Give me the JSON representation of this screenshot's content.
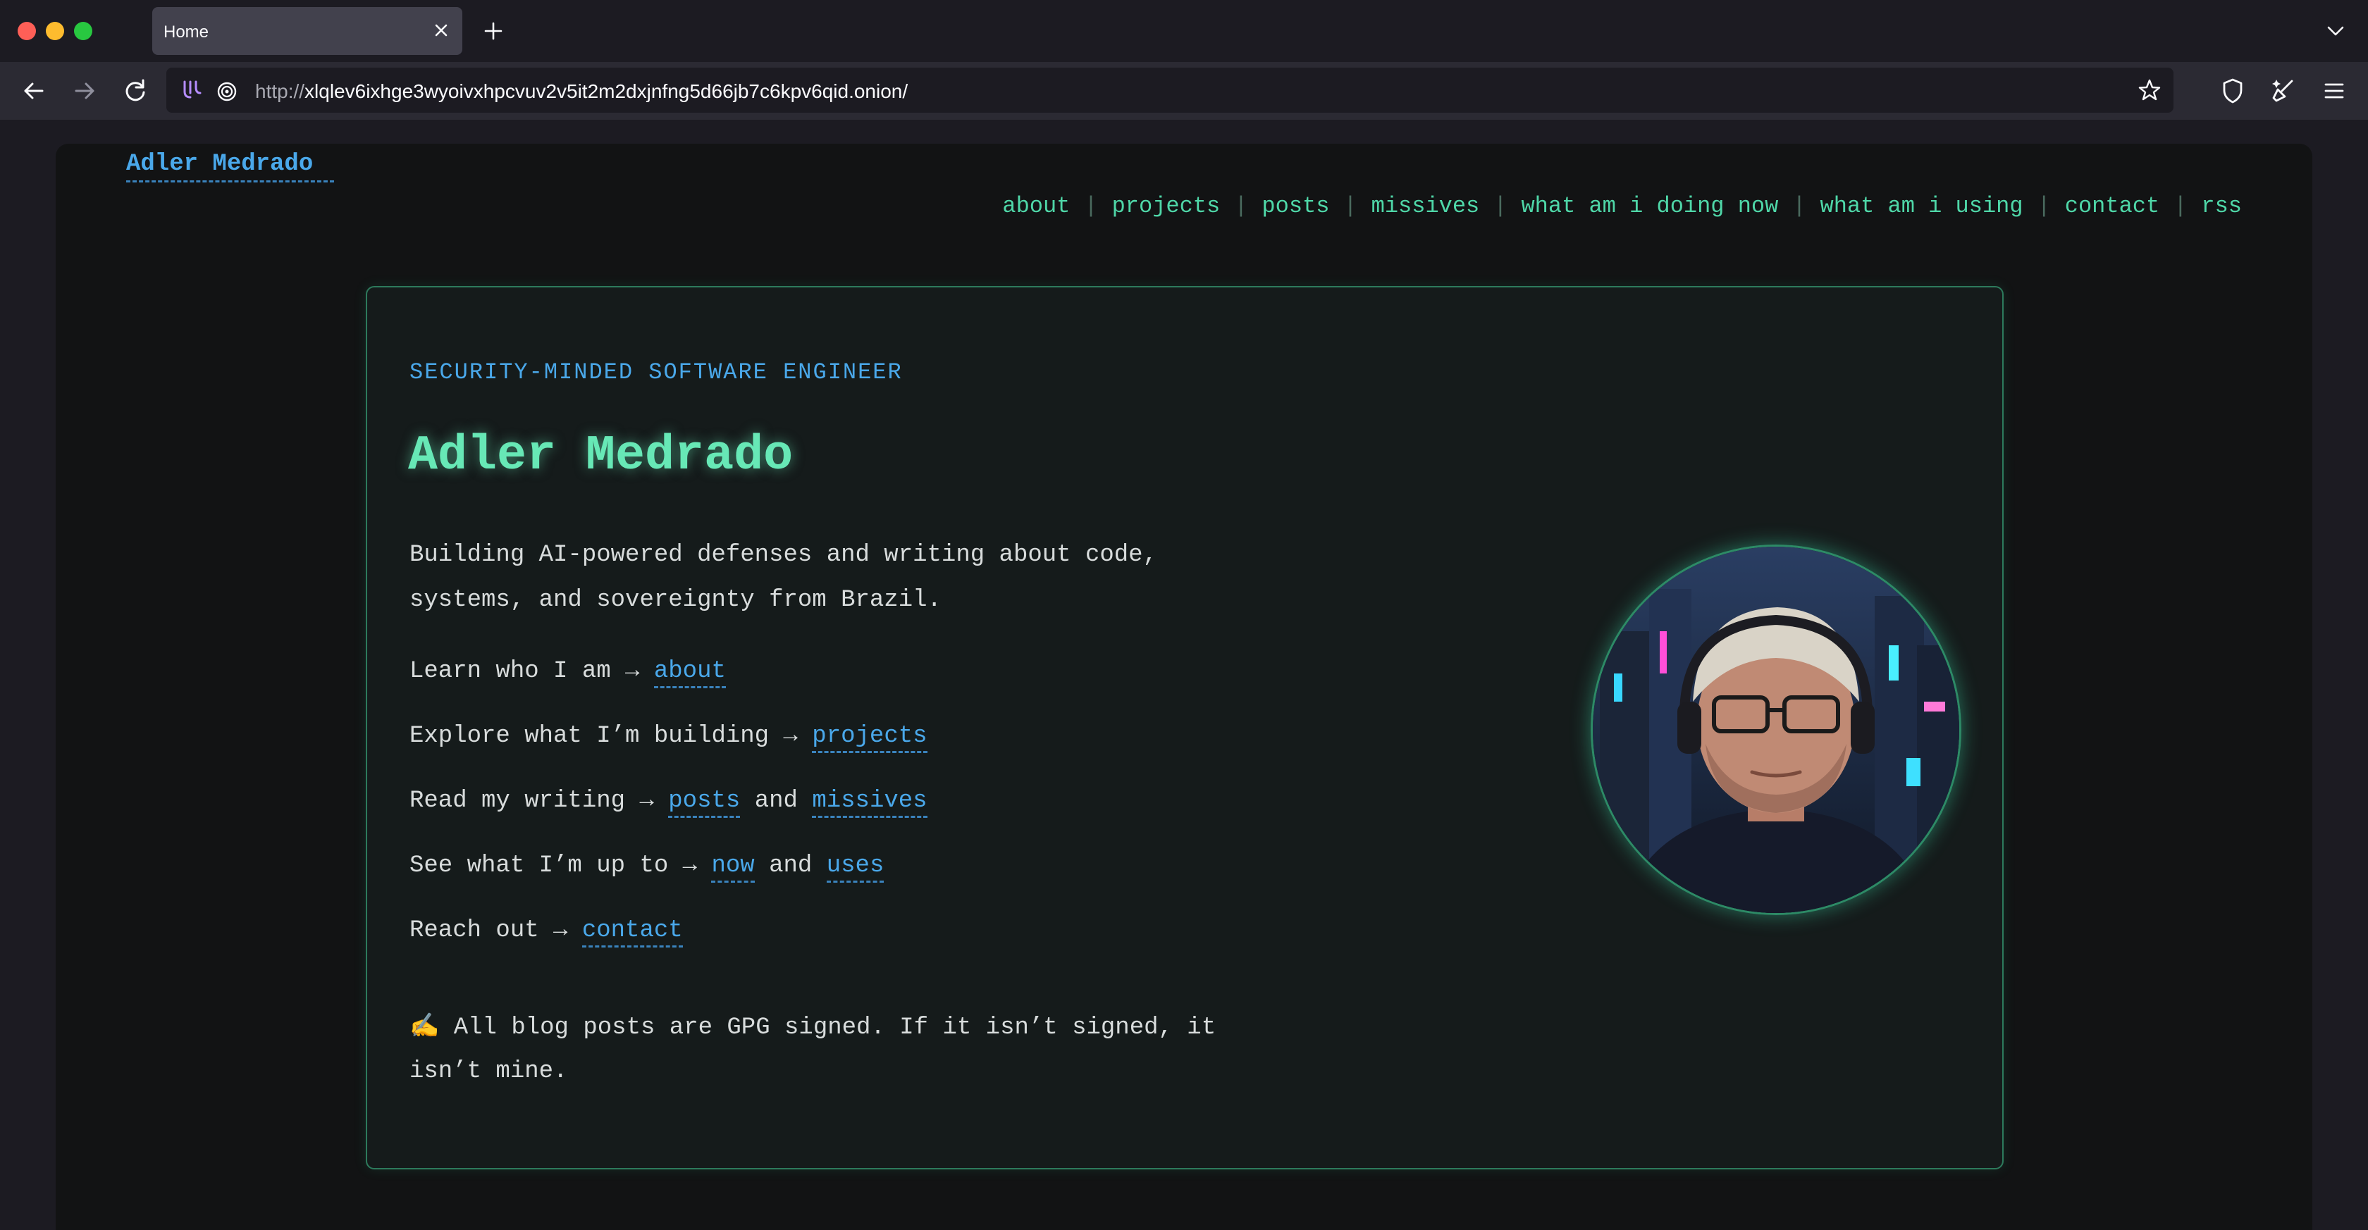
{
  "browser": {
    "tab_title": "Home",
    "url_scheme": "http://",
    "url_host": "xlqlev6ixhge3wyoivxhpcvuv2v5it2m2dxjnfng5d66jb7c6kpv6qid.onion/"
  },
  "site": {
    "brand": "Adler Medrado",
    "nav": [
      "about",
      "projects",
      "posts",
      "missives",
      "what am i doing now",
      "what am i using",
      "contact",
      "rss"
    ]
  },
  "hero": {
    "eyebrow": "SECURITY-MINDED SOFTWARE ENGINEER",
    "title": "Adler Medrado",
    "intro": "Building AI-powered defenses and writing about code, systems, and sovereignty from Brazil.",
    "lines": {
      "about_prefix": "Learn who I am → ",
      "about_link": "about",
      "projects_prefix": "Explore what I’m building → ",
      "projects_link": "projects",
      "writing_prefix": "Read my writing → ",
      "posts_link": "posts",
      "and_1": " and ",
      "missives_link": "missives",
      "upto_prefix": "See what I’m up to → ",
      "now_link": "now",
      "and_2": " and ",
      "uses_link": "uses",
      "reach_prefix": "Reach out → ",
      "contact_link": "contact"
    },
    "gpg_note": "✍️ All blog posts are GPG signed. If it isn’t signed, it isn’t mine."
  },
  "colors": {
    "accent_green": "#67e8b6",
    "accent_blue": "#4aa8ea",
    "card_border": "#2d7a5c"
  }
}
